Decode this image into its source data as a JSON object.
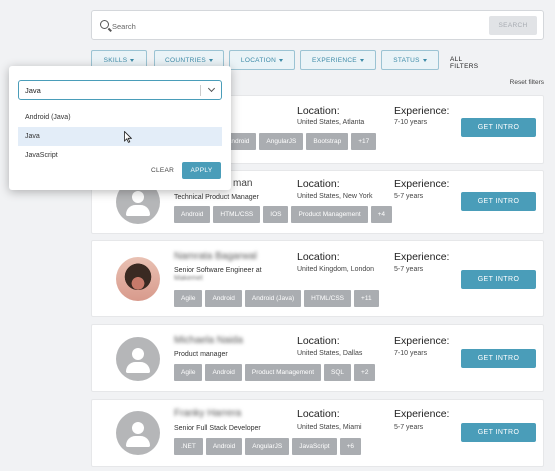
{
  "search": {
    "placeholder": "Search",
    "value": "",
    "button_label": "SEARCH"
  },
  "filters": [
    {
      "label": "SKILLS"
    },
    {
      "label": "COUNTRIES"
    },
    {
      "label": "LOCATION"
    },
    {
      "label": "EXPERIENCE"
    },
    {
      "label": "STATUS"
    }
  ],
  "all_filters_label": "ALL FILTERS",
  "reset_filters_label": "Reset filters",
  "popup": {
    "select_value": "Java",
    "options": [
      "Android (Java)",
      "Java",
      "JavaScript"
    ],
    "selected_index": 1,
    "clear_label": "CLEAR",
    "apply_label": "APPLY"
  },
  "location_label": "Location:",
  "experience_label": "Experience:",
  "intro_label": "GET INTRO",
  "candidates": [
    {
      "name": "",
      "role": "",
      "location": "United States, Atlanta",
      "experience": "7-10 years",
      "tags": [
        "Android",
        "AngularJS",
        "Bootstrap",
        "+17"
      ]
    },
    {
      "name": "man",
      "role": "Technical Product Manager",
      "location": "United States, New York",
      "experience": "5-7 years",
      "tags": [
        "Android",
        "HTML/CSS",
        "IOS",
        "Product Management",
        "+4"
      ]
    },
    {
      "name": "Namrata Bagarwal",
      "role": "Senior Software Engineer at",
      "role_sub": "Makemet",
      "location": "United Kingdom, London",
      "experience": "5-7 years",
      "tags": [
        "Agile",
        "Android",
        "Android (Java)",
        "HTML/CSS",
        "+11"
      ]
    },
    {
      "name": "Michaela Naida",
      "role": "Product manager",
      "location": "United States, Dallas",
      "experience": "7-10 years",
      "tags": [
        "Agile",
        "Android",
        "Product Management",
        "SQL",
        "+2"
      ]
    },
    {
      "name": "Franky Harrera",
      "role": "Senior Full Stack Developer",
      "location": "United States, Miami",
      "experience": "5-7 years",
      "tags": [
        ".NET",
        "Android",
        "AngularJS",
        "JavaScript",
        "+6"
      ]
    }
  ],
  "colors": {
    "accent": "#4a9db9",
    "tag": "#aaadb1",
    "filter_text": "#3c8aa7"
  }
}
